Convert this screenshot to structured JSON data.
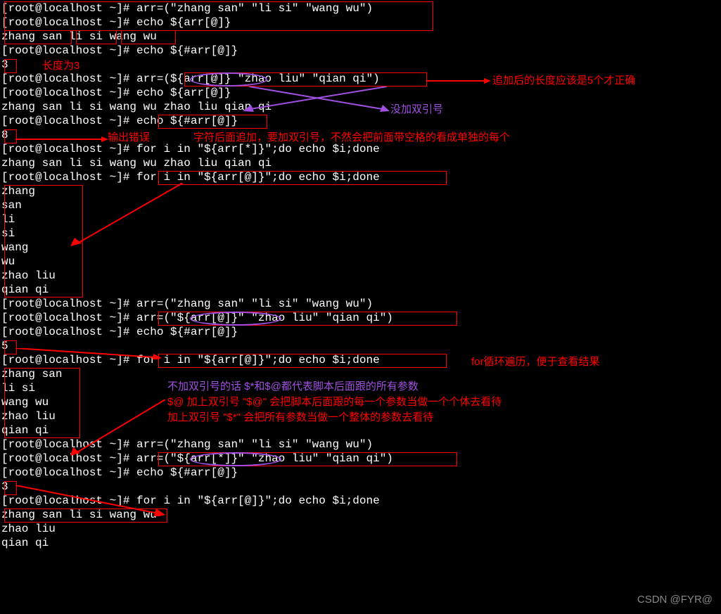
{
  "lines": {
    "l0": "[root@localhost ~]# arr=(\"zhang san\" \"li si\" \"wang wu\")",
    "l1": "[root@localhost ~]# echo ${arr[@]}",
    "l2": "zhang san li si wang wu",
    "l3": "[root@localhost ~]# echo ${#arr[@]}",
    "l4": "3",
    "l5": "[root@localhost ~]# arr=(${arr[@]} \"zhao liu\" \"qian qi\")",
    "l6": "[root@localhost ~]# echo ${arr[@]}",
    "l7": "zhang san li si wang wu zhao liu qian qi",
    "l8": "[root@localhost ~]# echo ${#arr[@]}",
    "l9": "8",
    "l10": "[root@localhost ~]# for i in \"${arr[*]}\";do echo $i;done",
    "l11": "zhang san li si wang wu zhao liu qian qi",
    "l12": "[root@localhost ~]# for i in \"${arr[@]}\";do echo $i;done",
    "l13": "zhang",
    "l14": "san",
    "l15": "li",
    "l16": "si",
    "l17": "wang",
    "l18": "wu",
    "l19": "zhao liu",
    "l20": "qian qi",
    "l21": "[root@localhost ~]# arr=(\"zhang san\" \"li si\" \"wang wu\")",
    "l22": "[root@localhost ~]# arr=(\"${arr[@]}\" \"zhao liu\" \"qian qi\")",
    "l23": "[root@localhost ~]# echo ${#arr[@]}",
    "l24": "5",
    "l25": "[root@localhost ~]# for i in \"${arr[@]}\";do echo $i;done",
    "l26": "zhang san",
    "l27": "li si",
    "l28": "wang wu",
    "l29": "zhao liu",
    "l30": "qian qi",
    "l31": "[root@localhost ~]# arr=(\"zhang san\" \"li si\" \"wang wu\")",
    "l32": "[root@localhost ~]# arr=(\"${arr[*]}\" \"zhao liu\" \"qian qi\")",
    "l33": "[root@localhost ~]# echo ${#arr[@]}",
    "l34": "3",
    "l35": "[root@localhost ~]# for i in \"${arr[@]}\";do echo $i;done",
    "l36": "zhang san li si wang wu",
    "l37": "zhao liu",
    "l38": "qian qi"
  },
  "annotations": {
    "len3": "长度为3",
    "append_wrong": "追加后的长度应该是5个才正确",
    "no_quotes": "没加双引号",
    "out_wrong": "输出错误",
    "append_note": "字符后面追加，要加双引号，不然会把前面带空格的看成单独的每个",
    "for_loop": "for循环遍历，便于查看结果",
    "no_q_same": "不加双引号的话 $*和$@都代表脚本后面跟的所有参数",
    "at_quote": "$@ 加上双引号 \"$@\" 会把脚本后面跟的每一个参数当做一个个体去看待",
    "star_quote": "加上双引号 \"$*\" 会把所有参数当做一个整体的参数去看待"
  },
  "watermark": "CSDN @FYR@"
}
